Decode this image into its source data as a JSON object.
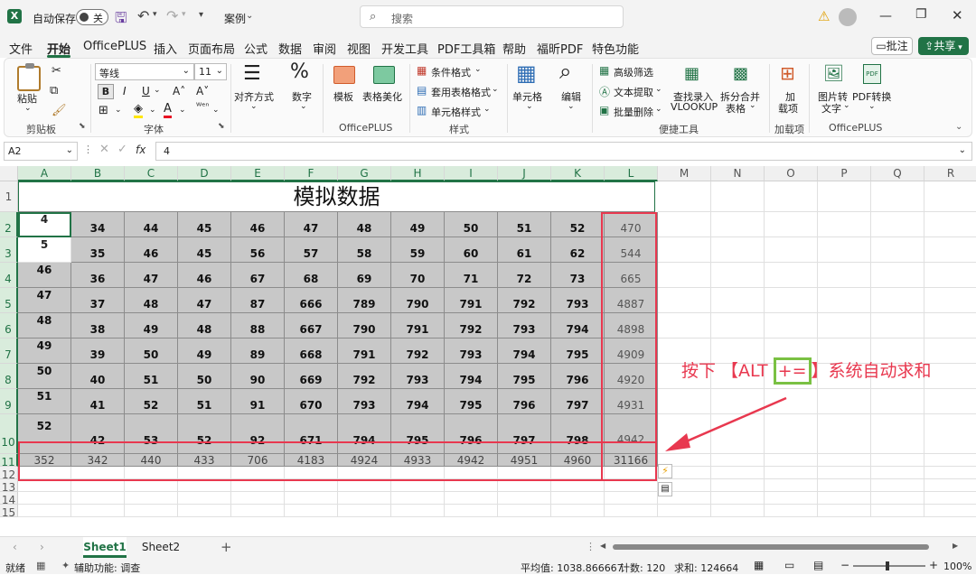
{
  "titlebar": {
    "autosave_label": "自动保存",
    "autosave_state": "关",
    "filename": "案例",
    "search_placeholder": "搜索"
  },
  "menu": [
    "文件",
    "开始",
    "OfficePLUS",
    "插入",
    "页面布局",
    "公式",
    "数据",
    "审阅",
    "视图",
    "开发工具",
    "PDF工具箱",
    "帮助",
    "福昕PDF",
    "特色功能"
  ],
  "menu_active": "开始",
  "menu_right": {
    "comment": "批注",
    "share": "共享"
  },
  "ribbon": {
    "paste": "粘贴",
    "clipboard": "剪贴板",
    "font_name": "等线",
    "font_size": "11",
    "font_group": "字体",
    "align": "对齐方式",
    "number": "数字",
    "template": "模板",
    "beautify": "表格美化",
    "officeplus": "OfficePLUS",
    "cond_format": "条件格式",
    "table_style": "套用表格格式",
    "cell_style": "单元格样式",
    "style_group": "样式",
    "cells": "单元格",
    "edit": "编辑",
    "adv_filter": "高级筛选",
    "text_extract": "文本提取",
    "batch_delete": "批量删除",
    "vlookup_1": "查找录入",
    "vlookup_2": "VLOOKUP",
    "split_1": "拆分合并",
    "split_2": "表格",
    "convenient": "便捷工具",
    "addin_1": "加",
    "addin_2": "载项",
    "addin_group": "加载项",
    "img2txt_1": "图片转",
    "img2txt_2": "文字",
    "pdf_1": "PDF转换",
    "officeplus2": "OfficePLUS"
  },
  "formula": {
    "namebox": "A2",
    "fx": "fx",
    "value": "4"
  },
  "columns": [
    "A",
    "B",
    "C",
    "D",
    "E",
    "F",
    "G",
    "H",
    "I",
    "J",
    "K",
    "L",
    "M",
    "N",
    "O",
    "P",
    "Q",
    "R"
  ],
  "rows": [
    "1",
    "2",
    "3",
    "4",
    "5",
    "6",
    "7",
    "8",
    "9",
    "10",
    "11",
    "12",
    "13",
    "14",
    "15"
  ],
  "sheet_title": "模拟数据",
  "data_rows": [
    [
      "4",
      "34",
      "44",
      "45",
      "46",
      "47",
      "48",
      "49",
      "50",
      "51",
      "52",
      "470"
    ],
    [
      "5",
      "35",
      "46",
      "45",
      "56",
      "57",
      "58",
      "59",
      "60",
      "61",
      "62",
      "544"
    ],
    [
      "46",
      "36",
      "47",
      "46",
      "67",
      "68",
      "69",
      "70",
      "71",
      "72",
      "73",
      "665"
    ],
    [
      "47",
      "37",
      "48",
      "47",
      "87",
      "666",
      "789",
      "790",
      "791",
      "792",
      "793",
      "4887"
    ],
    [
      "48",
      "38",
      "49",
      "48",
      "88",
      "667",
      "790",
      "791",
      "792",
      "793",
      "794",
      "4898"
    ],
    [
      "49",
      "39",
      "50",
      "49",
      "89",
      "668",
      "791",
      "792",
      "793",
      "794",
      "795",
      "4909"
    ],
    [
      "50",
      "40",
      "51",
      "50",
      "90",
      "669",
      "792",
      "793",
      "794",
      "795",
      "796",
      "4920"
    ],
    [
      "51",
      "41",
      "52",
      "51",
      "91",
      "670",
      "793",
      "794",
      "795",
      "796",
      "797",
      "4931"
    ],
    [
      "52",
      "42",
      "53",
      "52",
      "92",
      "671",
      "794",
      "795",
      "796",
      "797",
      "798",
      "4942"
    ]
  ],
  "sum_row": [
    "352",
    "342",
    "440",
    "433",
    "706",
    "4183",
    "4924",
    "4933",
    "4942",
    "4951",
    "4960",
    "31166"
  ],
  "annotation": {
    "part1": "按下 【ALT ",
    "key": "+=",
    "part2": "】系统自动求和"
  },
  "tabs": {
    "sheet1": "Sheet1",
    "sheet2": "Sheet2"
  },
  "status": {
    "ready": "就绪",
    "accessibility": "辅助功能: 调查",
    "average": "平均值: 1038.866667",
    "count": "计数: 120",
    "sum": "求和: 124664",
    "zoom": "100%"
  },
  "colors": {
    "excel_green": "#217346",
    "annot_red": "#e8384f",
    "key_green": "#7ac143"
  }
}
